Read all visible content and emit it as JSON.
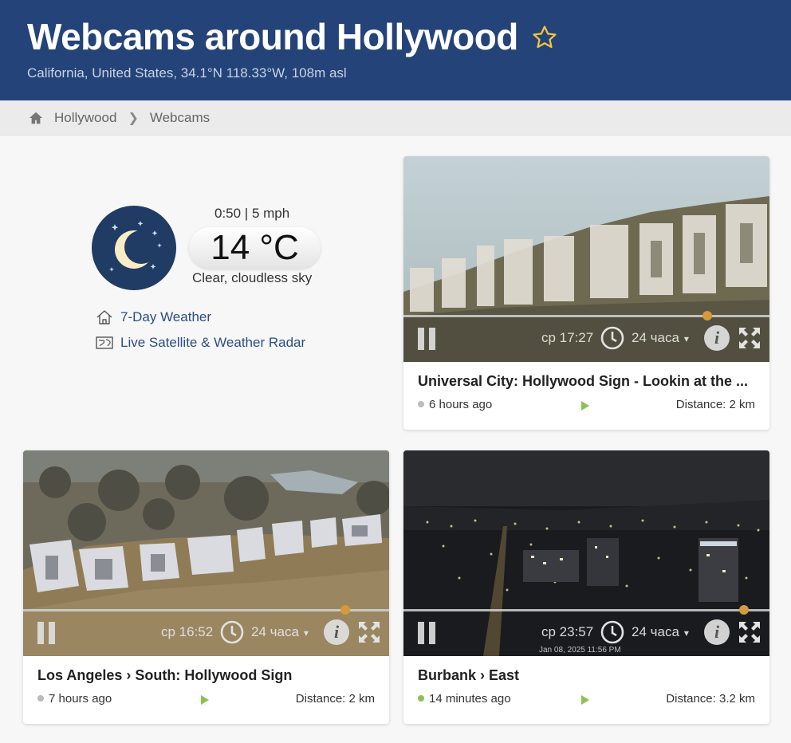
{
  "header": {
    "title": "Webcams around Hollywood",
    "subtitle": "California, United States, 34.1°N 118.33°W, 108m asl",
    "accent": "#244378"
  },
  "breadcrumb": {
    "items": [
      "Hollywood",
      "Webcams"
    ]
  },
  "weather": {
    "time_wind": "0:50 | 5 mph",
    "temperature": "14 °C",
    "description": "Clear, cloudless sky",
    "links": [
      "7-Day Weather",
      "Live Satellite & Weather Radar"
    ]
  },
  "webcams": [
    {
      "title": "Universal City: Hollywood Sign - Lookin at the ...",
      "time": "ср 17:27",
      "period": "24 часа",
      "progress": 0.83,
      "updated": "6 hours ago",
      "status_color": "#bbbbbb",
      "distance": "Distance: 2 km",
      "stamp": ""
    },
    {
      "title": "Los Angeles › South: Hollywood Sign",
      "time": "ср 16:52",
      "period": "24 часа",
      "progress": 0.88,
      "updated": "7 hours ago",
      "status_color": "#bbbbbb",
      "distance": "Distance: 2 km",
      "stamp": ""
    },
    {
      "title": "Burbank › East",
      "time": "ср 23:57",
      "period": "24 часа",
      "progress": 0.93,
      "updated": "14 minutes ago",
      "status_color": "#8cc152",
      "distance": "Distance: 3.2 km",
      "stamp": "Jan 08, 2025 11:56 PM"
    }
  ]
}
